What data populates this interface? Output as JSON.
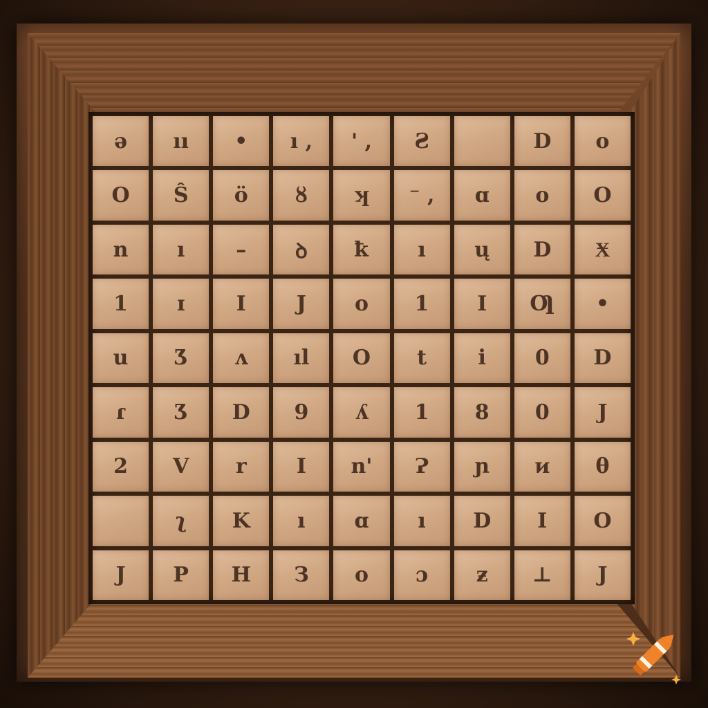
{
  "scene": {
    "description_free": true,
    "board": {
      "rows": 9,
      "cols": 9,
      "glyphs": [
        [
          "ə",
          "ıı",
          "•",
          "ı ,",
          "' ,",
          "Ƨ",
          "",
          "D",
          "o"
        ],
        [
          "O",
          "Ŝ",
          "ö",
          "ȣ",
          "ʞ",
          "⁻ ,",
          "ɑ",
          "o",
          "O"
        ],
        [
          "n",
          "ı",
          "–",
          "ꝺ",
          "ꝁ",
          "ı",
          "ų",
          "D",
          "Ӿ"
        ],
        [
          "1",
          "ɪ",
          "I",
          "J",
          "o",
          "1",
          "I",
          "Ƣ",
          "•"
        ],
        [
          "u",
          "Ʒ",
          "ʌ",
          "ıl",
          "O",
          "t",
          "ⅰ",
          "0",
          "D"
        ],
        [
          "ɾ",
          "Ʒ",
          "D",
          "9",
          "ʎ",
          "1",
          "8",
          "0",
          "J"
        ],
        [
          "2",
          "V",
          "r",
          "I",
          "n'",
          "Ɂ",
          "ɲ",
          "ᴎ",
          "θ"
        ],
        [
          "",
          "ʅ",
          "K",
          "ı",
          "ɑ",
          "ı",
          "D",
          "I",
          "O"
        ],
        [
          "J",
          "P",
          "H",
          "З",
          "o",
          "ɔ",
          "ƶ",
          "⊥",
          "J"
        ]
      ]
    },
    "colors": {
      "tile": "#d2a985",
      "glyph": "#3b2417",
      "frame": "#6e4427",
      "logo": "#f0822a"
    },
    "logo_icon": "crayon-logo-icon"
  }
}
